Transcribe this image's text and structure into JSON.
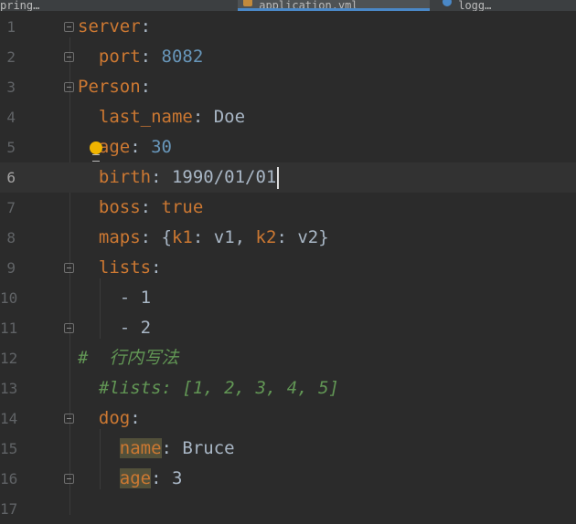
{
  "tabs": [
    {
      "label": "pring…",
      "active": false
    },
    {
      "label": "application.yml",
      "active": true
    },
    {
      "label": "logg…",
      "active": false
    }
  ],
  "editor": {
    "current_line": 6,
    "lines": [
      {
        "num": "1"
      },
      {
        "num": "2"
      },
      {
        "num": "3"
      },
      {
        "num": "4"
      },
      {
        "num": "5"
      },
      {
        "num": "6"
      },
      {
        "num": "7"
      },
      {
        "num": "8"
      },
      {
        "num": "9"
      },
      {
        "num": "10"
      },
      {
        "num": "11"
      },
      {
        "num": "12"
      },
      {
        "num": "13"
      },
      {
        "num": "14"
      },
      {
        "num": "15"
      },
      {
        "num": "16"
      },
      {
        "num": "17"
      }
    ],
    "tokens": {
      "server": "server",
      "port": "port",
      "port_val": "8082",
      "person": "Person",
      "last_name": "last_name",
      "last_name_val": "Doe",
      "age": "age",
      "age_val": "30",
      "birth": "birth",
      "birth_val": "1990/01/01",
      "boss": "boss",
      "boss_val": "true",
      "maps": "maps",
      "k1": "k1",
      "v1": "v1",
      "k2": "k2",
      "v2": "v2",
      "lists": "lists",
      "list_item_1": "1",
      "list_item_2": "2",
      "comment_1": "#  行内写法",
      "comment_2": "#lists: [1, 2, 3, 4, 5]",
      "dog": "dog",
      "dog_name": "name",
      "dog_name_val": "Bruce",
      "dog_age": "age",
      "dog_age_val": "3"
    }
  },
  "colors": {
    "background": "#2b2b2b",
    "keyword": "#cc7832",
    "number": "#6897bb",
    "comment": "#629755",
    "text": "#a9b7c6"
  }
}
